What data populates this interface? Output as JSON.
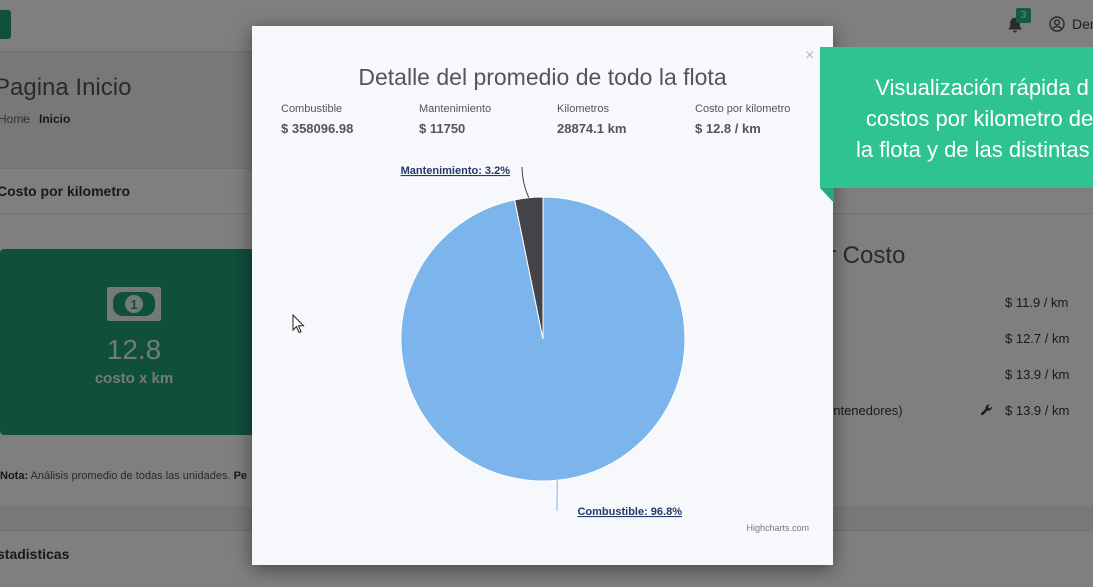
{
  "header": {
    "notifications_count": "3",
    "user_name": "Demo"
  },
  "page": {
    "title": "Pagina Inicio",
    "breadcrumb_home": "Home",
    "breadcrumb_sep": "/",
    "breadcrumb_current": "Inicio"
  },
  "cost_panel": {
    "title": "Costo por kilometro",
    "kpi_value": "12.8",
    "kpi_label": "costo x km",
    "note_bold": "Nota:",
    "note_text": " Análisis promedio de todas las unidades. ",
    "note_trailing": "Pe"
  },
  "ranking": {
    "title": "r Costo",
    "rows": [
      "$ 11.9 / km",
      "$ 12.7 / km",
      "$ 13.9 / km",
      "$ 13.9 / km"
    ],
    "last_row_label": "ontenedores)"
  },
  "stats_panel": {
    "title": "stadisticas"
  },
  "modal": {
    "close_label": "×",
    "chart_title": "Detalle del promedio de todo la flota",
    "stats": [
      {
        "label": "Combustible",
        "value": "$ 358096.98"
      },
      {
        "label": "Mantenimiento",
        "value": "$ 11750"
      },
      {
        "label": "Kilometros",
        "value": "28874.1 km"
      },
      {
        "label": "Costo por kilometro",
        "value": "$ 12.8 / km"
      }
    ],
    "credits": "Highcharts.com"
  },
  "chart_data": {
    "type": "pie",
    "title": "Detalle del promedio de todo la flota",
    "slices": [
      {
        "name": "Combustible",
        "value": 96.8,
        "label": "Combustible: 96.8%",
        "color": "#7cb5ec"
      },
      {
        "name": "Mantenimiento",
        "value": 3.2,
        "label": "Mantenimiento: 3.2%",
        "color": "#434348"
      }
    ]
  },
  "banner": {
    "lines": [
      "Visualización rápida d",
      "costos por kilometro del",
      "la flota y de las distintas u"
    ],
    "color": "#2ec38f"
  }
}
